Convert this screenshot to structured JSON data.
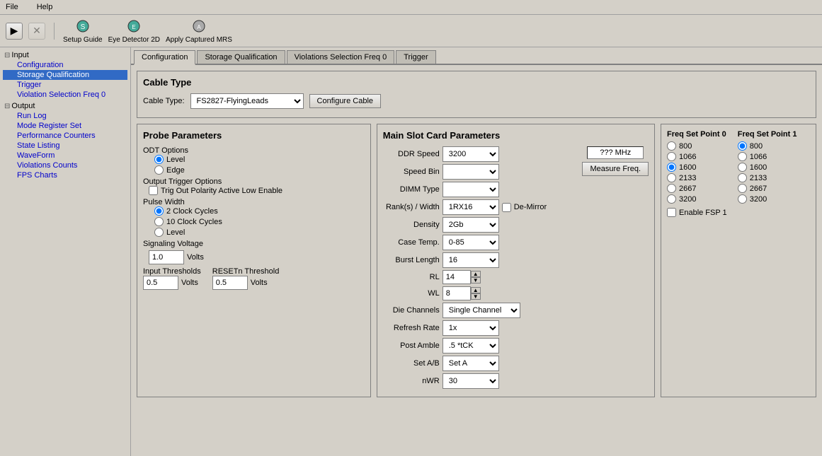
{
  "menubar": {
    "items": [
      "File",
      "Help"
    ]
  },
  "toolbar": {
    "setup_guide_label": "Setup Guide",
    "eye_detector_label": "Eye Detector 2D",
    "apply_captured_label": "Apply Captured MRS"
  },
  "sidebar": {
    "input_label": "Input",
    "input_items": [
      "Configuration",
      "Storage Qualification",
      "Trigger",
      "Violation Selection Freq 0"
    ],
    "output_label": "Output",
    "output_items": [
      "Run Log",
      "Mode Register Set",
      "Performance Counters",
      "State Listing",
      "WaveForm",
      "Violations Counts",
      "FPS Charts"
    ]
  },
  "tabs": {
    "items": [
      "Configuration",
      "Storage Qualification",
      "Violations Selection Freq 0",
      "Trigger"
    ],
    "active": "Configuration"
  },
  "cable_type": {
    "section_title": "Cable Type",
    "label": "Cable Type:",
    "value": "FS2827-FlyingLeads",
    "options": [
      "FS2827-FlyingLeads"
    ],
    "configure_btn": "Configure Cable"
  },
  "probe_params": {
    "section_title": "Probe Parameters",
    "odt_label": "ODT Options",
    "odt_options": [
      "Level",
      "Edge"
    ],
    "odt_selected": "Level",
    "output_trigger_label": "Output Trigger Options",
    "trig_checkbox_label": "Trig Out Polarity Active Low Enable",
    "trig_checked": false,
    "pulse_width_label": "Pulse Width",
    "pulse_width_options": [
      "2 Clock Cycles",
      "10 Clock Cycles",
      "Level"
    ],
    "pulse_width_selected": "2 Clock Cycles",
    "signaling_voltage_label": "Signaling Voltage",
    "signaling_voltage_value": "1.0",
    "volts_label": "Volts",
    "input_thresholds_label": "Input Thresholds",
    "input_thresholds_value": "0.5",
    "resetn_threshold_label": "RESETn Threshold",
    "resetn_threshold_value": "0.5",
    "volts_label2": "Volts",
    "volts_label3": "Volts"
  },
  "main_slot": {
    "section_title": "Main Slot Card Parameters",
    "ddr_speed_label": "DDR Speed",
    "ddr_speed_value": "3200",
    "ddr_speed_options": [
      "3200"
    ],
    "measure_mhz_label": "??? MHz",
    "measure_freq_btn": "Measure Freq.",
    "speed_bin_label": "Speed Bin",
    "dimm_type_label": "DIMM Type",
    "ranks_label": "Rank(s) / Width",
    "ranks_value": "1RX16",
    "ranks_options": [
      "1RX16"
    ],
    "de_mirror_label": "De-Mirror",
    "de_mirror_checked": false,
    "density_label": "Density",
    "density_value": "2Gb",
    "density_options": [
      "2Gb"
    ],
    "case_temp_label": "Case Temp.",
    "case_temp_value": "0-85",
    "case_temp_options": [
      "0-85"
    ],
    "burst_length_label": "Burst Length",
    "burst_length_value": "16",
    "burst_length_options": [
      "16"
    ],
    "rl_label": "RL",
    "rl_value": "14",
    "wl_label": "WL",
    "wl_value": "8",
    "die_channels_label": "Die Channels",
    "die_channels_value": "Single Channel",
    "die_channels_options": [
      "Single Channel"
    ],
    "refresh_rate_label": "Refresh Rate",
    "refresh_rate_value": "1x",
    "refresh_rate_options": [
      "1x"
    ],
    "post_amble_label": "Post Amble",
    "post_amble_value": ".5 *tCK",
    "post_amble_options": [
      ".5 *tCK"
    ],
    "set_ab_label": "Set A/B",
    "set_ab_value": "Set A",
    "set_ab_options": [
      "Set A"
    ],
    "nwr_label": "nWR",
    "nwr_value": "30",
    "nwr_options": [
      "30"
    ]
  },
  "freq_set_points": {
    "point0_title": "Freq Set Point 0",
    "point1_title": "Freq Set Point 1",
    "options": [
      "800",
      "1066",
      "1600",
      "2133",
      "2667",
      "3200"
    ],
    "selected0": "1600",
    "selected1": "800",
    "enable_fsp1_label": "Enable FSP 1",
    "enable_fsp1_checked": false
  }
}
